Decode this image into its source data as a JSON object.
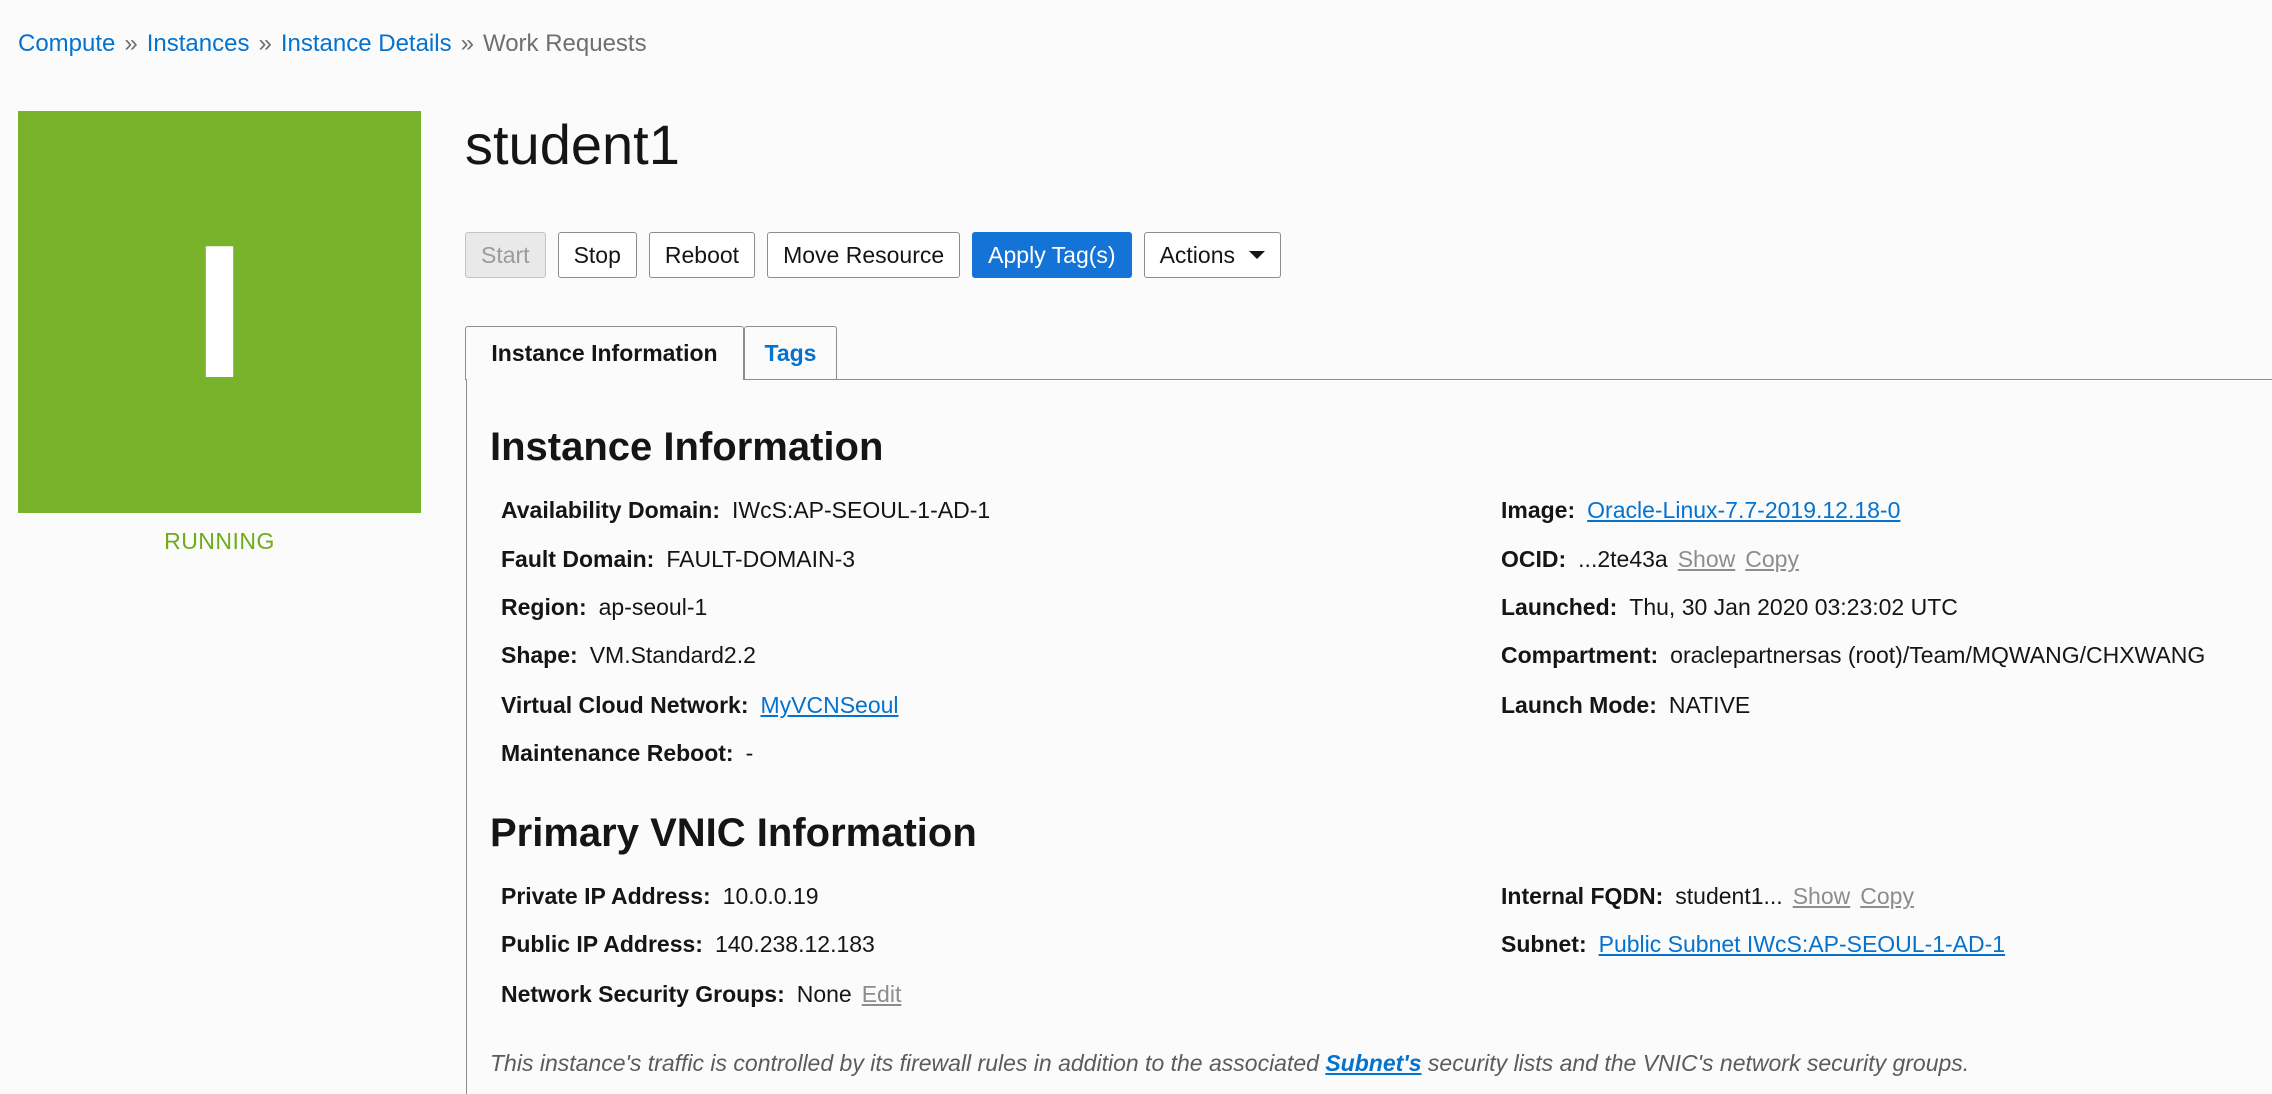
{
  "breadcrumb": {
    "items": [
      "Compute",
      "Instances",
      "Instance Details"
    ],
    "current": "Work Requests",
    "separator": "»"
  },
  "badge": {
    "letter": "I",
    "status": "RUNNING",
    "color": "#79b22b"
  },
  "title": "student1",
  "toolbar": {
    "start": "Start",
    "stop": "Stop",
    "reboot": "Reboot",
    "move": "Move Resource",
    "apply_tags": "Apply Tag(s)",
    "actions": "Actions"
  },
  "tabs": {
    "info": "Instance Information",
    "tags": "Tags"
  },
  "instance_info": {
    "heading": "Instance Information",
    "availability_domain": {
      "label": "Availability Domain:",
      "value": "IWcS:AP-SEOUL-1-AD-1"
    },
    "fault_domain": {
      "label": "Fault Domain:",
      "value": "FAULT-DOMAIN-3"
    },
    "region": {
      "label": "Region:",
      "value": "ap-seoul-1"
    },
    "shape": {
      "label": "Shape:",
      "value": "VM.Standard2.2"
    },
    "vcn": {
      "label": "Virtual Cloud Network:",
      "value": "MyVCNSeoul"
    },
    "maintenance": {
      "label": "Maintenance Reboot:",
      "value": "-"
    },
    "image": {
      "label": "Image:",
      "value": "Oracle-Linux-7.7-2019.12.18-0"
    },
    "ocid": {
      "label": "OCID:",
      "value": "...2te43a",
      "show": "Show",
      "copy": "Copy"
    },
    "launched": {
      "label": "Launched:",
      "value": "Thu, 30 Jan 2020 03:23:02 UTC"
    },
    "compartment": {
      "label": "Compartment:",
      "value": "oraclepartnersas (root)/Team/MQWANG/CHXWANG"
    },
    "launch_mode": {
      "label": "Launch Mode:",
      "value": "NATIVE"
    }
  },
  "vnic_info": {
    "heading": "Primary VNIC Information",
    "private_ip": {
      "label": "Private IP Address:",
      "value": "10.0.0.19"
    },
    "public_ip": {
      "label": "Public IP Address:",
      "value": "140.238.12.183"
    },
    "nsg": {
      "label": "Network Security Groups:",
      "value": "None",
      "edit": "Edit"
    },
    "fqdn": {
      "label": "Internal FQDN:",
      "value": "student1...",
      "show": "Show",
      "copy": "Copy"
    },
    "subnet": {
      "label": "Subnet:",
      "value": "Public Subnet IWcS:AP-SEOUL-1-AD-1"
    }
  },
  "note": {
    "before": "This instance's traffic is controlled by its firewall rules in addition to the associated ",
    "link": "Subnet's",
    "after": " security lists and the VNIC's network security groups."
  }
}
